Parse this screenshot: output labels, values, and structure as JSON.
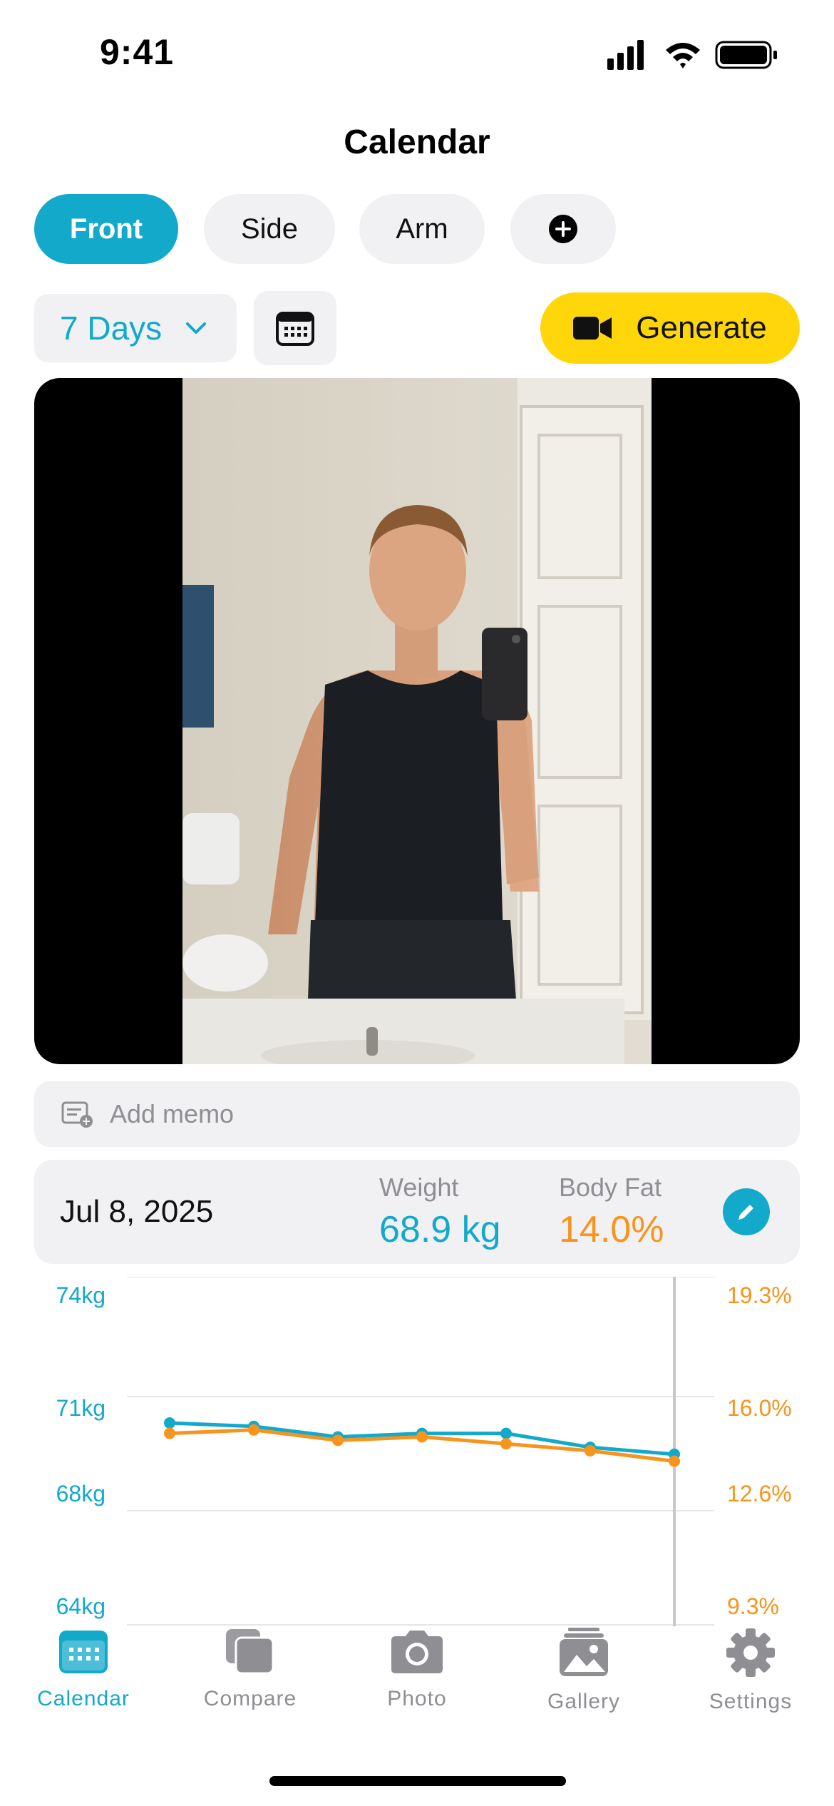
{
  "status_bar": {
    "time": "9:41"
  },
  "header": {
    "title": "Calendar"
  },
  "pose_tabs": [
    {
      "label": "Front",
      "active": true
    },
    {
      "label": "Side",
      "active": false
    },
    {
      "label": "Arm",
      "active": false
    }
  ],
  "controls": {
    "range_label": "7 Days",
    "generate_label": "Generate"
  },
  "memo": {
    "placeholder": "Add memo"
  },
  "entry": {
    "date": "Jul 8, 2025",
    "weight_label": "Weight",
    "weight_value": "68.9 kg",
    "bodyfat_label": "Body Fat",
    "bodyfat_value": "14.0%"
  },
  "colors": {
    "accent": "#12a9cb",
    "bodyfat": "#f7941d",
    "generate": "#ffd60a"
  },
  "chart_data": {
    "type": "line",
    "left_axis_ticks": [
      "74kg",
      "71kg",
      "68kg",
      "64kg"
    ],
    "right_axis_ticks": [
      "19.3%",
      "16.0%",
      "12.6%",
      "9.3%"
    ],
    "series": [
      {
        "axis": "left",
        "unit": "kg",
        "values": [
          69.8,
          69.7,
          69.4,
          69.5,
          69.5,
          69.1,
          68.9
        ]
      },
      {
        "axis": "right",
        "unit": "%",
        "values": [
          14.8,
          14.9,
          14.6,
          14.7,
          14.5,
          14.3,
          14.0
        ]
      }
    ],
    "selected_index": 6
  },
  "tabbar": [
    {
      "label": "Calendar",
      "icon": "calendar-icon",
      "active": true
    },
    {
      "label": "Compare",
      "icon": "compare-icon",
      "active": false
    },
    {
      "label": "Photo",
      "icon": "camera-icon",
      "active": false
    },
    {
      "label": "Gallery",
      "icon": "gallery-icon",
      "active": false
    },
    {
      "label": "Settings",
      "icon": "gear-icon",
      "active": false
    }
  ]
}
